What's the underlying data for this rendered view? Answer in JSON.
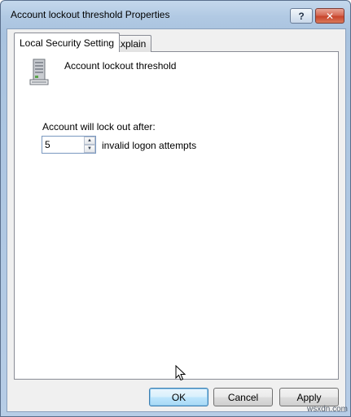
{
  "window": {
    "title": "Account lockout threshold Properties",
    "help_label": "?",
    "close_label": "✕"
  },
  "tabs": [
    {
      "label": "Local Security Setting",
      "active": true
    },
    {
      "label": "Explain",
      "active": false
    }
  ],
  "setting": {
    "icon": "server-tower-icon",
    "policy_name": "Account lockout threshold",
    "lockout_label": "Account will lock out after:",
    "value": "5",
    "unit_label": "invalid logon attempts"
  },
  "buttons": {
    "ok": "OK",
    "cancel": "Cancel",
    "apply": "Apply"
  },
  "watermark": "wsxdn.com",
  "colors": {
    "titlebar": "#b1c9e3",
    "close_button": "#c8442c",
    "default_button": "#bee6fd"
  }
}
